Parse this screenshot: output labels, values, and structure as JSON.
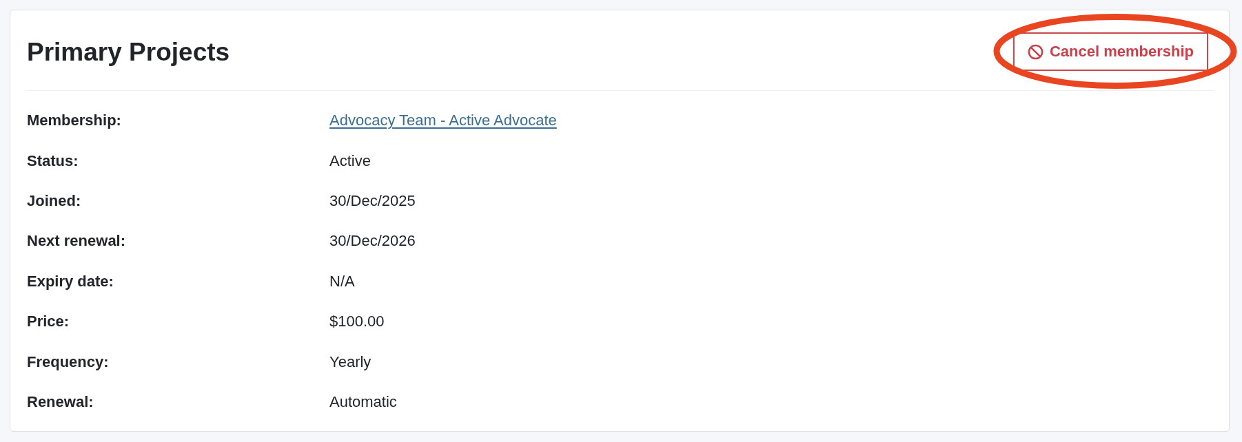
{
  "card": {
    "title": "Primary Projects",
    "action": {
      "label": "Cancel membership",
      "highlighted": true
    }
  },
  "details": [
    {
      "label": "Membership:",
      "value": "Advocacy Team - Active Advocate",
      "kind": "link"
    },
    {
      "label": "Status:",
      "value": "Active",
      "kind": "text"
    },
    {
      "label": "Joined:",
      "value": "30/Dec/2025",
      "kind": "text"
    },
    {
      "label": "Next renewal:",
      "value": "30/Dec/2026",
      "kind": "text"
    },
    {
      "label": "Expiry date:",
      "value": "N/A",
      "kind": "text"
    },
    {
      "label": "Price:",
      "value": "$100.00",
      "kind": "text"
    },
    {
      "label": "Frequency:",
      "value": "Yearly",
      "kind": "text"
    },
    {
      "label": "Renewal:",
      "value": "Automatic",
      "kind": "text"
    }
  ]
}
